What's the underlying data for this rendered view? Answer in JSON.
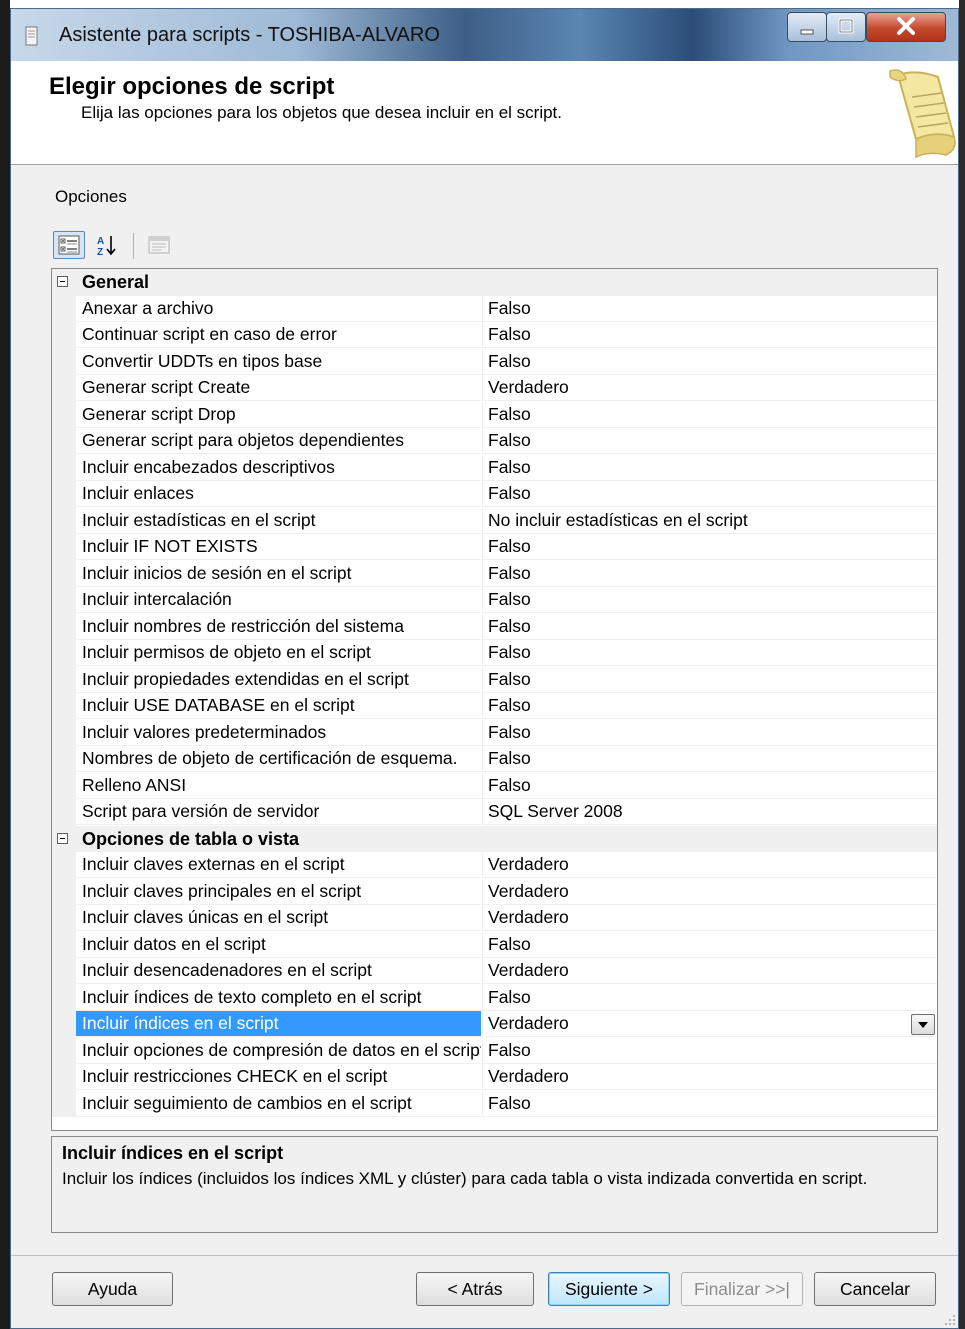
{
  "window": {
    "title": "Asistente para scripts - TOSHIBA-ALVARO"
  },
  "header": {
    "title": "Elegir opciones de script",
    "subtitle": "Elija las opciones para los objetos que desea incluir en el script."
  },
  "options_label": "Opciones",
  "toolbar": {
    "categorized_icon": "categorized-view-icon",
    "alphabetical_icon": "sort-az-icon",
    "property_pages_icon": "property-pages-icon"
  },
  "grid": {
    "categories": [
      {
        "name": "General",
        "rows": [
          {
            "name": "Anexar a archivo",
            "value": "Falso"
          },
          {
            "name": "Continuar script en caso de error",
            "value": "Falso"
          },
          {
            "name": "Convertir UDDTs en tipos base",
            "value": "Falso"
          },
          {
            "name": "Generar script Create",
            "value": "Verdadero"
          },
          {
            "name": "Generar script Drop",
            "value": "Falso"
          },
          {
            "name": "Generar script para objetos dependientes",
            "value": "Falso"
          },
          {
            "name": "Incluir encabezados descriptivos",
            "value": "Falso"
          },
          {
            "name": "Incluir enlaces",
            "value": "Falso"
          },
          {
            "name": "Incluir estadísticas en el script",
            "value": "No incluir estadísticas en el script"
          },
          {
            "name": "Incluir IF NOT EXISTS",
            "value": "Falso"
          },
          {
            "name": "Incluir inicios de sesión en el script",
            "value": "Falso"
          },
          {
            "name": "Incluir intercalación",
            "value": "Falso"
          },
          {
            "name": "Incluir nombres de restricción del sistema",
            "value": "Falso"
          },
          {
            "name": "Incluir permisos de objeto en el script",
            "value": "Falso"
          },
          {
            "name": "Incluir propiedades extendidas en el script",
            "value": "Falso"
          },
          {
            "name": "Incluir USE DATABASE en el script",
            "value": "Falso"
          },
          {
            "name": "Incluir valores predeterminados",
            "value": "Falso"
          },
          {
            "name": "Nombres de objeto de certificación de esquema.",
            "value": "Falso"
          },
          {
            "name": "Relleno ANSI",
            "value": "Falso"
          },
          {
            "name": "Script para versión de servidor",
            "value": "SQL Server 2008"
          }
        ]
      },
      {
        "name": "Opciones de tabla o vista",
        "rows": [
          {
            "name": "Incluir claves externas en el script",
            "value": "Verdadero"
          },
          {
            "name": "Incluir claves principales en el script",
            "value": "Verdadero"
          },
          {
            "name": "Incluir claves únicas en el script",
            "value": "Verdadero"
          },
          {
            "name": "Incluir datos en el script",
            "value": "Falso"
          },
          {
            "name": "Incluir desencadenadores en el script",
            "value": "Verdadero"
          },
          {
            "name": "Incluir índices de texto completo en el script",
            "value": "Falso"
          },
          {
            "name": "Incluir índices en el script",
            "value": "Verdadero",
            "selected": true
          },
          {
            "name": "Incluir opciones de compresión de datos en el script",
            "value": "Falso"
          },
          {
            "name": "Incluir restricciones CHECK en el script",
            "value": "Verdadero"
          },
          {
            "name": "Incluir seguimiento de cambios en el script",
            "value": "Falso"
          }
        ]
      }
    ]
  },
  "description": {
    "title": "Incluir índices en el script",
    "text": "Incluir los índices (incluidos los índices XML y clúster) para cada tabla o vista indizada convertida en script."
  },
  "buttons": {
    "help": "Ayuda",
    "back": "< Atrás",
    "next": "Siguiente >",
    "finish": "Finalizar >>|",
    "cancel": "Cancelar"
  }
}
